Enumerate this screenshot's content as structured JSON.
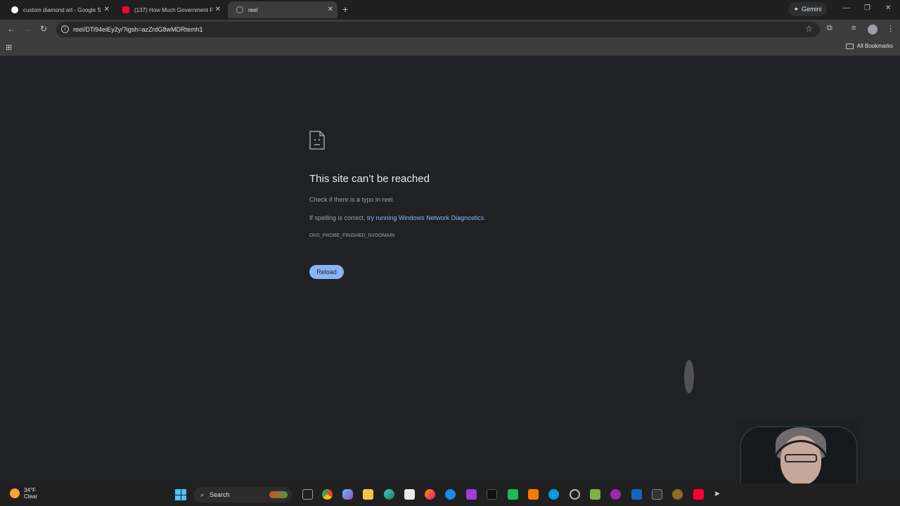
{
  "tabs": [
    {
      "title": "custom diamond art - Google S",
      "favicon": "google-icon",
      "color": "#ffffff"
    },
    {
      "title": "(137) How Much Government F",
      "favicon": "youtube-icon",
      "color": "#ff0033"
    },
    {
      "title": "reel",
      "favicon": "globe-icon",
      "color": "#9aa0a6"
    }
  ],
  "gemini_label": "Gemini",
  "address": {
    "url": "reel/DTi94eiEy2y/?igsh=azZrdG8wMDRtemh1"
  },
  "bookmarks": {
    "all_label": "All Bookmarks"
  },
  "error": {
    "title": "This site can’t be reached",
    "line1": "Check if there is a typo in reel.",
    "line2_prefix": "If spelling is correct, ",
    "line2_link": "try running Windows Network Diagnostics",
    "line2_suffix": ".",
    "code": "DNS_PROBE_FINISHED_NXDOMAIN",
    "reload_label": "Reload"
  },
  "taskbar": {
    "weather_temp": "34°F",
    "weather_desc": "Clear",
    "search_label": "Search",
    "apps": [
      "task-view-icon",
      "chrome-icon",
      "copilot-icon",
      "file-explorer-icon",
      "edge-icon",
      "store-icon",
      "firefox-icon",
      "messenger-icon",
      "picsart-icon",
      "capcut-icon",
      "app-green-icon",
      "app-orange-icon",
      "app-c-icon",
      "settings-icon",
      "app-leaf-icon",
      "app-purple-icon",
      "app-blue-icon",
      "inkscape-icon",
      "app-gold-icon",
      "youtube-icon",
      "cursor-icon"
    ]
  },
  "colors": {
    "link": "#8ab4f8",
    "reload_bg": "#8ab4f8",
    "page_bg": "#202124"
  }
}
